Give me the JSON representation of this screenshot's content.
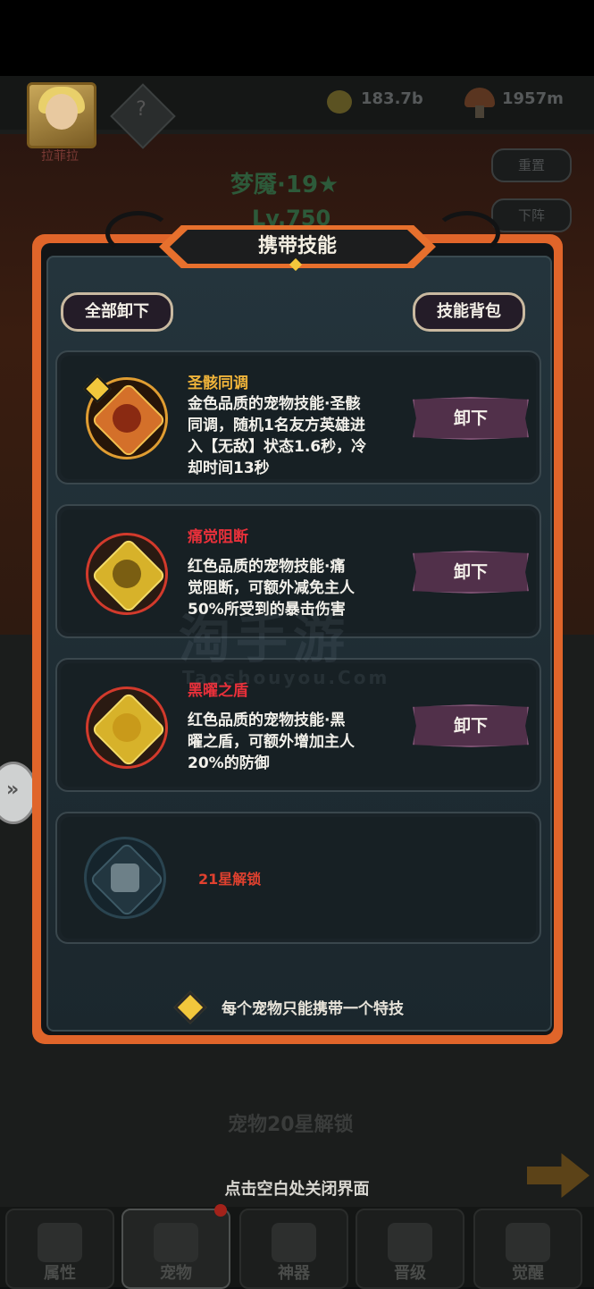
{
  "background": {
    "hero_name": "拉菲拉",
    "gold": "183.7b",
    "mushroom": "1957m",
    "reset_label": "重置",
    "dismiss_label": "下阵",
    "pet_title": "梦魇·19★",
    "pet_level": "Lv.750",
    "lock20_label": "宠物20星解锁",
    "close_hint": "点击空白处关闭界面",
    "nav": [
      "属性",
      "宠物",
      "神器",
      "晋级",
      "觉醒"
    ]
  },
  "modal": {
    "title": "携带技能",
    "unload_all_label": "全部卸下",
    "skill_bag_label": "技能背包",
    "skills": [
      {
        "name": "圣骸同调",
        "name_color": "#f0b43a",
        "desc": [
          "金色品质的宠物技能·圣骸",
          "同调，随机1名友方英雄进",
          "入【无敌】状态1.6秒，冷",
          "却时间13秒"
        ],
        "button": "卸下",
        "icon": "sun-burst-icon"
      },
      {
        "name": "痛觉阻断",
        "name_color": "#e8303a",
        "desc": [
          "红色品质的宠物技能·痛",
          "觉阻断，可额外减免主人",
          "50%所受到的暴击伤害"
        ],
        "button": "卸下",
        "icon": "claw-strike-icon"
      },
      {
        "name": "黑曜之盾",
        "name_color": "#e8303a",
        "desc": [
          "红色品质的宠物技能·黑",
          "曜之盾，可额外增加主人",
          "20%的防御"
        ],
        "button": "卸下",
        "icon": "shield-icon"
      }
    ],
    "locked_slot": {
      "label": "21星解锁",
      "icon": "lock-icon"
    },
    "footer_note": "每个宠物只能携带一个特技"
  },
  "watermark": {
    "big": "淘手游",
    "small": "Taoshouyou.Com"
  },
  "colors": {
    "accent_orange": "#e0652a",
    "gold": "#f2c73c",
    "red_text": "#e8303a",
    "button_purple": "#51304a"
  }
}
